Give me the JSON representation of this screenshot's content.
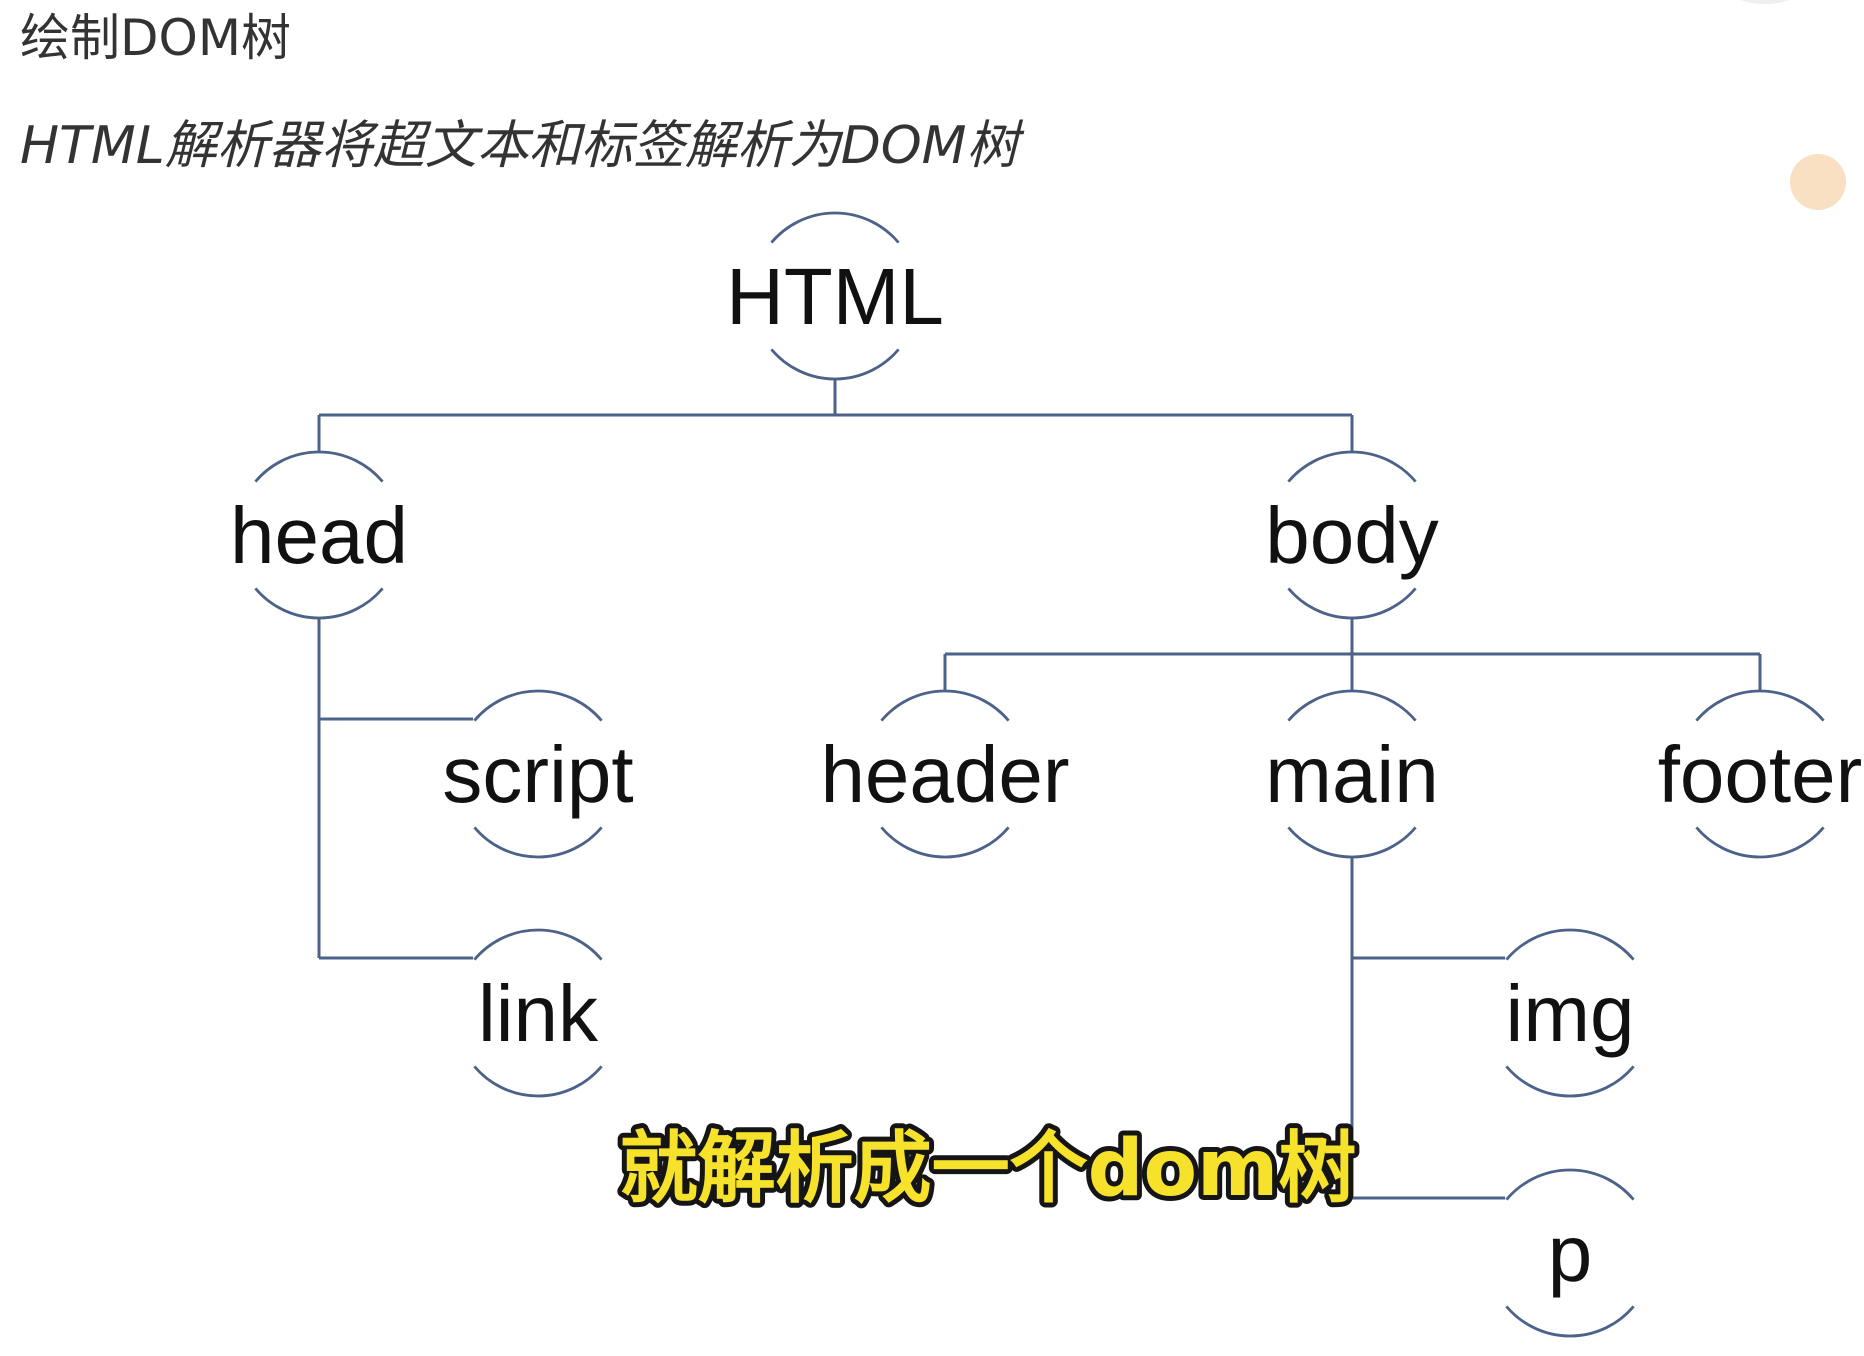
{
  "heading": "绘制DOM树",
  "subtitle": "HTML解析器将超文本和标签解析为DOM树",
  "caption": "就解析成一个dom树",
  "colors": {
    "connector": "#4c6288",
    "caption_fill": "#f6e12b",
    "caption_outline": "#151515",
    "decor_dot": "#f9e0c2"
  },
  "tree": {
    "nodes": [
      {
        "id": "html",
        "label": "HTML"
      },
      {
        "id": "head",
        "label": "head",
        "parent": "html"
      },
      {
        "id": "body",
        "label": "body",
        "parent": "html"
      },
      {
        "id": "script",
        "label": "script",
        "parent": "head"
      },
      {
        "id": "link",
        "label": "link",
        "parent": "head"
      },
      {
        "id": "header",
        "label": "header",
        "parent": "body"
      },
      {
        "id": "main",
        "label": "main",
        "parent": "body"
      },
      {
        "id": "footer",
        "label": "footer",
        "parent": "body"
      },
      {
        "id": "img",
        "label": "img",
        "parent": "main"
      },
      {
        "id": "p",
        "label": "p",
        "parent": "main"
      }
    ]
  }
}
